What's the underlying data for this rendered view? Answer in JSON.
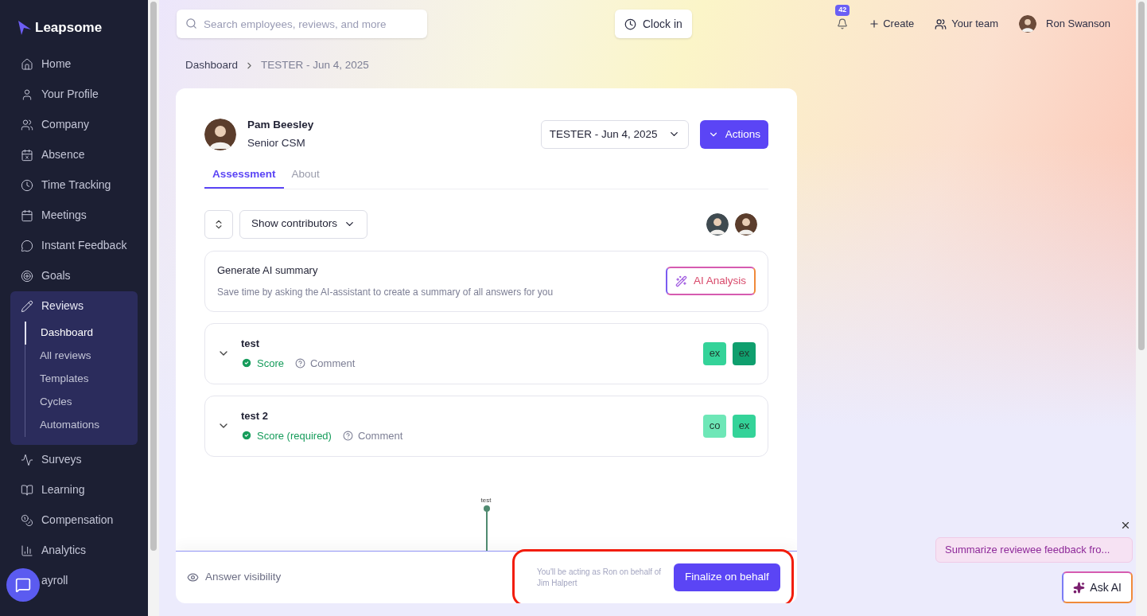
{
  "brand": "Leapsome",
  "nav": [
    {
      "label": "Home",
      "selected": false
    },
    {
      "label": "Your Profile",
      "selected": false
    },
    {
      "label": "Company",
      "selected": false
    },
    {
      "label": "Absence",
      "selected": false
    },
    {
      "label": "Time Tracking",
      "selected": false
    },
    {
      "label": "Meetings",
      "selected": false
    },
    {
      "label": "Instant Feedback",
      "selected": false
    },
    {
      "label": "Goals",
      "selected": false
    },
    {
      "label": "Reviews",
      "selected": true,
      "expanded": true,
      "children": [
        {
          "label": "Dashboard",
          "selected": true
        },
        {
          "label": "All reviews",
          "selected": false
        },
        {
          "label": "Templates",
          "selected": false
        },
        {
          "label": "Cycles",
          "selected": false
        },
        {
          "label": "Automations",
          "selected": false
        }
      ]
    },
    {
      "label": "Surveys",
      "selected": false
    },
    {
      "label": "Learning",
      "selected": false
    },
    {
      "label": "Compensation",
      "selected": false
    },
    {
      "label": "Analytics",
      "selected": false
    },
    {
      "label": "ayroll",
      "selected": false
    }
  ],
  "topbar": {
    "search_placeholder": "Search employees, reviews, and more",
    "clock_in": "Clock in",
    "notifications": "42",
    "create": "Create",
    "your_team": "Your team",
    "user": "Ron Swanson"
  },
  "breadcrumb": [
    "Dashboard",
    "TESTER - Jun 4, 2025"
  ],
  "review": {
    "name": "Pam Beesley",
    "role": "Senior CSM",
    "cycle": "TESTER - Jun 4, 2025",
    "actions": "Actions",
    "tabs": [
      {
        "label": "Assessment",
        "selected": true
      },
      {
        "label": "About",
        "selected": false
      }
    ],
    "show_contributors": "Show contributors",
    "ai_summary": {
      "title": "Generate AI summary",
      "description": "Save time by asking the AI-assistant to create a summary of all answers for you",
      "button": "AI Analysis"
    },
    "questions": [
      {
        "title": "test",
        "score": "Score",
        "score_done": true,
        "comment": "Comment",
        "chips": [
          {
            "label": "ex",
            "color": "#34d399"
          },
          {
            "label": "ex",
            "color": "#0f9f6e"
          }
        ]
      },
      {
        "title": "test 2",
        "score": "Score (required)",
        "score_done": true,
        "comment": "Comment",
        "chips": [
          {
            "label": "co",
            "color": "#6ee7b7"
          },
          {
            "label": "ex",
            "color": "#34d399"
          }
        ]
      }
    ],
    "chart_label": "test",
    "answer_visibility": "Answer visibility",
    "behalf_note": "You'll be acting as Ron on behalf of Jim Halpert",
    "finalize": "Finalize on behalf"
  },
  "assistant": {
    "suggestion": "Summarize reviewee feedback fro...",
    "ask": "Ask AI"
  }
}
